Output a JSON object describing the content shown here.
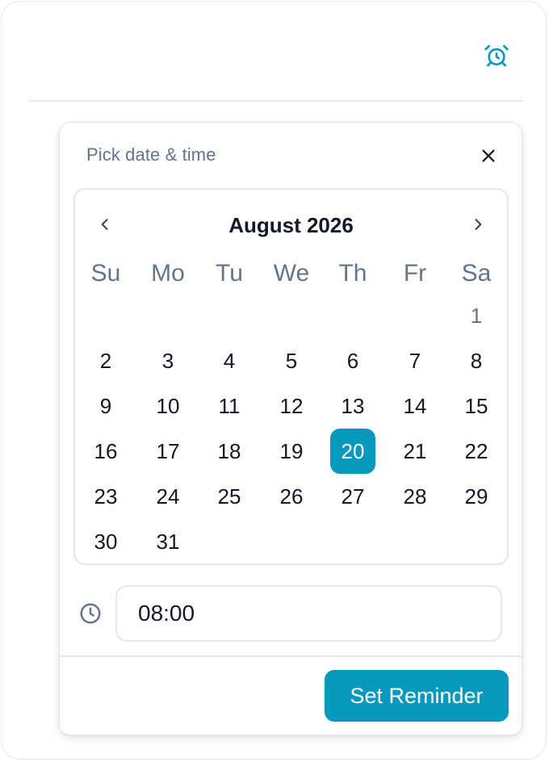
{
  "header": {
    "alarm_icon": "alarm-clock-icon"
  },
  "popover": {
    "title": "Pick date & time",
    "close_icon": "close-icon",
    "calendar": {
      "month_label": "August 2026",
      "prev_icon": "chevron-left-icon",
      "next_icon": "chevron-right-icon",
      "weekdays": [
        "Su",
        "Mo",
        "Tu",
        "We",
        "Th",
        "Fr",
        "Sa"
      ],
      "days": [
        "1",
        "2",
        "3",
        "4",
        "5",
        "6",
        "7",
        "8",
        "9",
        "10",
        "11",
        "12",
        "13",
        "14",
        "15",
        "16",
        "17",
        "18",
        "19",
        "20",
        "21",
        "22",
        "23",
        "24",
        "25",
        "26",
        "27",
        "28",
        "29",
        "30",
        "31"
      ],
      "selected_day": "20"
    },
    "time": {
      "icon": "clock-icon",
      "value": "08:00"
    },
    "submit_label": "Set Reminder"
  },
  "colors": {
    "accent": "#0798be",
    "muted_text": "#64748b",
    "border": "#e5e7eb"
  }
}
